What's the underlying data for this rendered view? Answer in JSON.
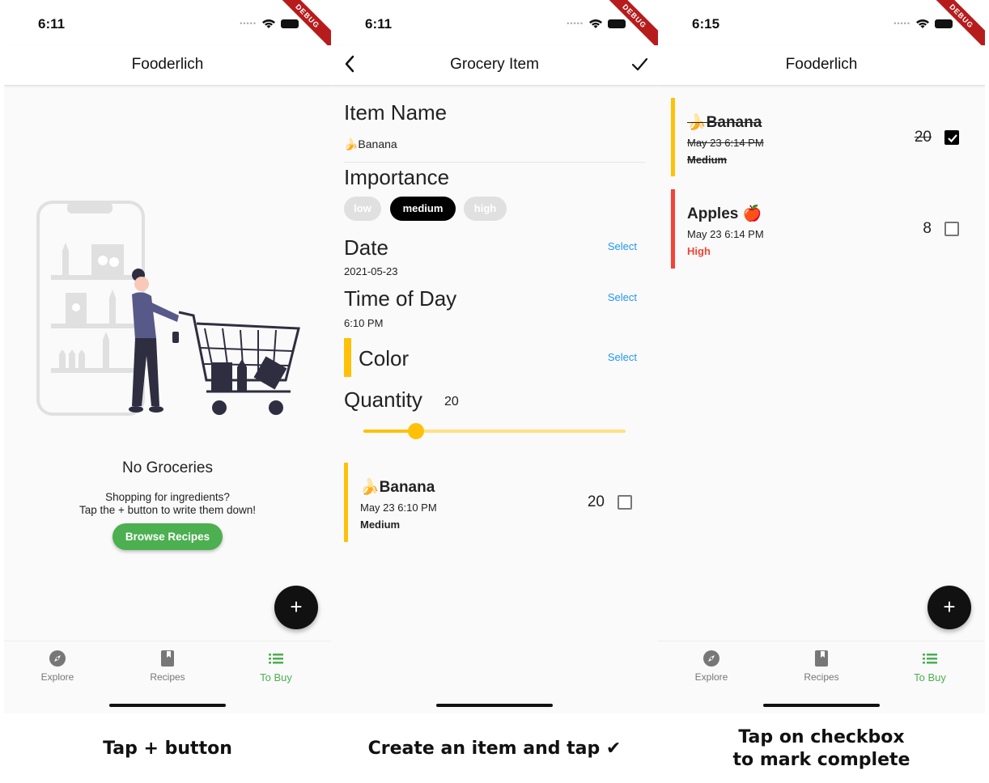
{
  "screens": [
    {
      "status_time": "6:11",
      "debug_label": "DEBUG",
      "app_title": "Fooderlich",
      "empty": {
        "title": "No Groceries",
        "line1": "Shopping for ingredients?",
        "line2": "Tap the + button to write them down!",
        "button": "Browse Recipes"
      },
      "fab_symbol": "+",
      "nav": [
        {
          "label": "Explore",
          "icon": "compass-icon"
        },
        {
          "label": "Recipes",
          "icon": "book-icon"
        },
        {
          "label": "To Buy",
          "icon": "list-icon",
          "active": true
        }
      ]
    },
    {
      "status_time": "6:11",
      "debug_label": "DEBUG",
      "app_title": "Grocery Item",
      "form": {
        "item_name_heading": "Item Name",
        "item_name_value": "🍌Banana",
        "importance_heading": "Importance",
        "chips": [
          "low",
          "medium",
          "high"
        ],
        "selected_chip": "medium",
        "date_heading": "Date",
        "date_value": "2021-05-23",
        "select_label": "Select",
        "time_heading": "Time of Day",
        "time_value": "6:10 PM",
        "color_heading": "Color",
        "quantity_heading": "Quantity",
        "quantity_value": "20",
        "slider_fraction": 0.2
      },
      "preview": {
        "name": "🍌Banana",
        "date": "May 23 6:10 PM",
        "importance": "Medium",
        "quantity": "20",
        "checked": false
      }
    },
    {
      "status_time": "6:15",
      "debug_label": "DEBUG",
      "app_title": "Fooderlich",
      "items": [
        {
          "name": "🍌Banana",
          "date": "May 23 6:14 PM",
          "importance": "Medium",
          "quantity": "20",
          "checked": true,
          "color": "#ffc107"
        },
        {
          "name": "Apples 🍎",
          "date": "May 23 6:14 PM",
          "importance": "High",
          "quantity": "8",
          "checked": false,
          "color": "#f44336"
        }
      ],
      "fab_symbol": "+",
      "nav": [
        {
          "label": "Explore",
          "icon": "compass-icon"
        },
        {
          "label": "Recipes",
          "icon": "book-icon"
        },
        {
          "label": "To Buy",
          "icon": "list-icon",
          "active": true
        }
      ]
    }
  ],
  "captions": [
    "Tap + button",
    "Create an item and tap ✔",
    "Tap on checkbox",
    "to mark complete"
  ],
  "colors": {
    "accent": "#4caf50",
    "link": "#2196f3",
    "slider": "#ffc107",
    "high": "#f44336"
  }
}
